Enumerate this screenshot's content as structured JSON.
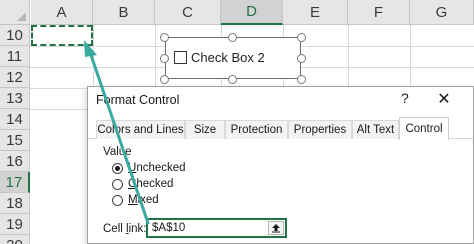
{
  "sheet": {
    "columns": [
      "A",
      "B",
      "C",
      "D",
      "E",
      "F",
      "G"
    ],
    "selected_column": "D",
    "rows": [
      "10",
      "11",
      "12",
      "13",
      "14",
      "15",
      "16",
      "17",
      "18",
      "19",
      "20"
    ],
    "selected_row": "17"
  },
  "form_control": {
    "checkbox_label": "Check Box 2"
  },
  "dialog": {
    "title": "Format Control",
    "help": "?",
    "close": "✕",
    "tabs": [
      "Colors and Lines",
      "Size",
      "Protection",
      "Properties",
      "Alt Text",
      "Control"
    ],
    "active_tab": "Control",
    "value_group_label": "Value",
    "radios": [
      {
        "pre": "",
        "key": "U",
        "post": "nchecked",
        "selected": true
      },
      {
        "pre": "",
        "key": "C",
        "post": "hecked",
        "selected": false
      },
      {
        "pre": "",
        "key": "M",
        "post": "ixed",
        "selected": false
      }
    ],
    "cell_link_label_pre": "Cell ",
    "cell_link_label_key": "l",
    "cell_link_label_post": "ink:",
    "cell_link_value": "$A$10"
  },
  "colors": {
    "accent": "#217346",
    "arrow": "#3aa9a1"
  }
}
